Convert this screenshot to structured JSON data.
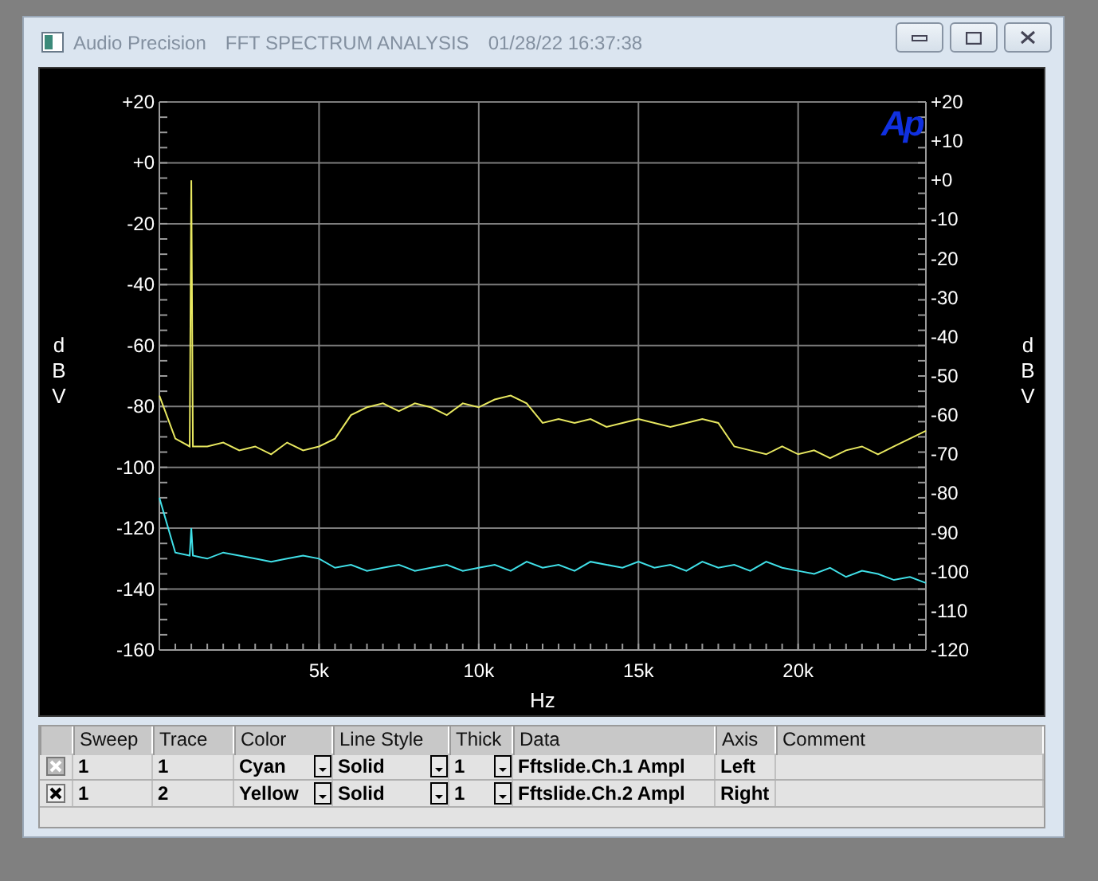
{
  "window": {
    "app": "Audio Precision",
    "title": "FFT SPECTRUM ANALYSIS",
    "timestamp": "01/28/22 16:37:38"
  },
  "graph": {
    "logo": "Ap",
    "chart_data": {
      "type": "line",
      "grid": true,
      "xlabel": "Hz",
      "ylabel": "dBV",
      "y2label": "dBV",
      "xlim": [
        0,
        24000
      ],
      "ylim": [
        -160,
        20
      ],
      "y2lim": [
        -120,
        20
      ],
      "xticks": [
        {
          "value": 5000,
          "label": "5k"
        },
        {
          "value": 10000,
          "label": "10k"
        },
        {
          "value": 15000,
          "label": "15k"
        },
        {
          "value": 20000,
          "label": "20k"
        }
      ],
      "yticks": [
        {
          "value": 20,
          "label": "+20"
        },
        {
          "value": 0,
          "label": "+0"
        },
        -20,
        -40,
        -60,
        -80,
        -100,
        -120,
        -140,
        -160
      ],
      "y2ticks": [
        {
          "value": 20,
          "label": "+20"
        },
        {
          "value": 10,
          "label": "+10"
        },
        {
          "value": 0,
          "label": "+0"
        },
        -10,
        -20,
        -30,
        -40,
        -50,
        -60,
        -70,
        -80,
        -90,
        -100,
        -110,
        -120
      ],
      "x": [
        0,
        500,
        950,
        1000,
        1050,
        1500,
        2000,
        2500,
        3000,
        3500,
        4000,
        4500,
        5000,
        5500,
        6000,
        6500,
        7000,
        7500,
        8000,
        8500,
        9000,
        9500,
        10000,
        10500,
        11000,
        11500,
        12000,
        12500,
        13000,
        13500,
        14000,
        14500,
        15000,
        15500,
        16000,
        16500,
        17000,
        17500,
        18000,
        18500,
        19000,
        19500,
        20000,
        20500,
        21000,
        21500,
        22000,
        22500,
        23000,
        23500,
        24000
      ],
      "series": [
        {
          "color": "#40e0e8",
          "values": [
            -110,
            -128,
            -129,
            -120,
            -129,
            -130,
            -128,
            -129,
            -130,
            -131,
            -130,
            -129,
            -130,
            -133,
            -132,
            -134,
            -133,
            -132,
            -134,
            -133,
            -132,
            -134,
            -133,
            -132,
            -134,
            -131,
            -133,
            -132,
            -134,
            -131,
            -132,
            -133,
            -131,
            -133,
            -132,
            -134,
            -131,
            -133,
            -132,
            -134,
            -131,
            -133,
            -134,
            -135,
            -133,
            -136,
            -134,
            -135,
            -137,
            -136,
            -138
          ]
        },
        {
          "color": "#e8e860",
          "axis": "y2",
          "values": [
            -55,
            -66,
            -68,
            0,
            -68,
            -68,
            -67,
            -69,
            -68,
            -70,
            -67,
            -69,
            -68,
            -66,
            -60,
            -58,
            -57,
            -59,
            -57,
            -58,
            -60,
            -57,
            -58,
            -56,
            -55,
            -57,
            -62,
            -61,
            -62,
            -61,
            -63,
            -62,
            -61,
            -62,
            -63,
            -62,
            -61,
            -62,
            -68,
            -69,
            -70,
            -68,
            -70,
            -69,
            -71,
            -69,
            -68,
            -70,
            -68,
            -66,
            -64
          ]
        }
      ]
    }
  },
  "legend": {
    "columns": [
      "Sweep",
      "Trace",
      "Color",
      "Line Style",
      "Thick",
      "Data",
      "Axis",
      "Comment"
    ],
    "rows": [
      {
        "checked": true,
        "disabled": true,
        "sweep": "1",
        "trace": "1",
        "color_name": "Cyan",
        "line_style": "Solid",
        "thick": "1",
        "data": "Fftslide.Ch.1 Ampl",
        "axis": "Left"
      },
      {
        "checked": true,
        "disabled": false,
        "sweep": "1",
        "trace": "2",
        "color_name": "Yellow",
        "line_style": "Solid",
        "thick": "1",
        "data": "Fftslide.Ch.2 Ampl",
        "axis": "Right"
      }
    ]
  }
}
